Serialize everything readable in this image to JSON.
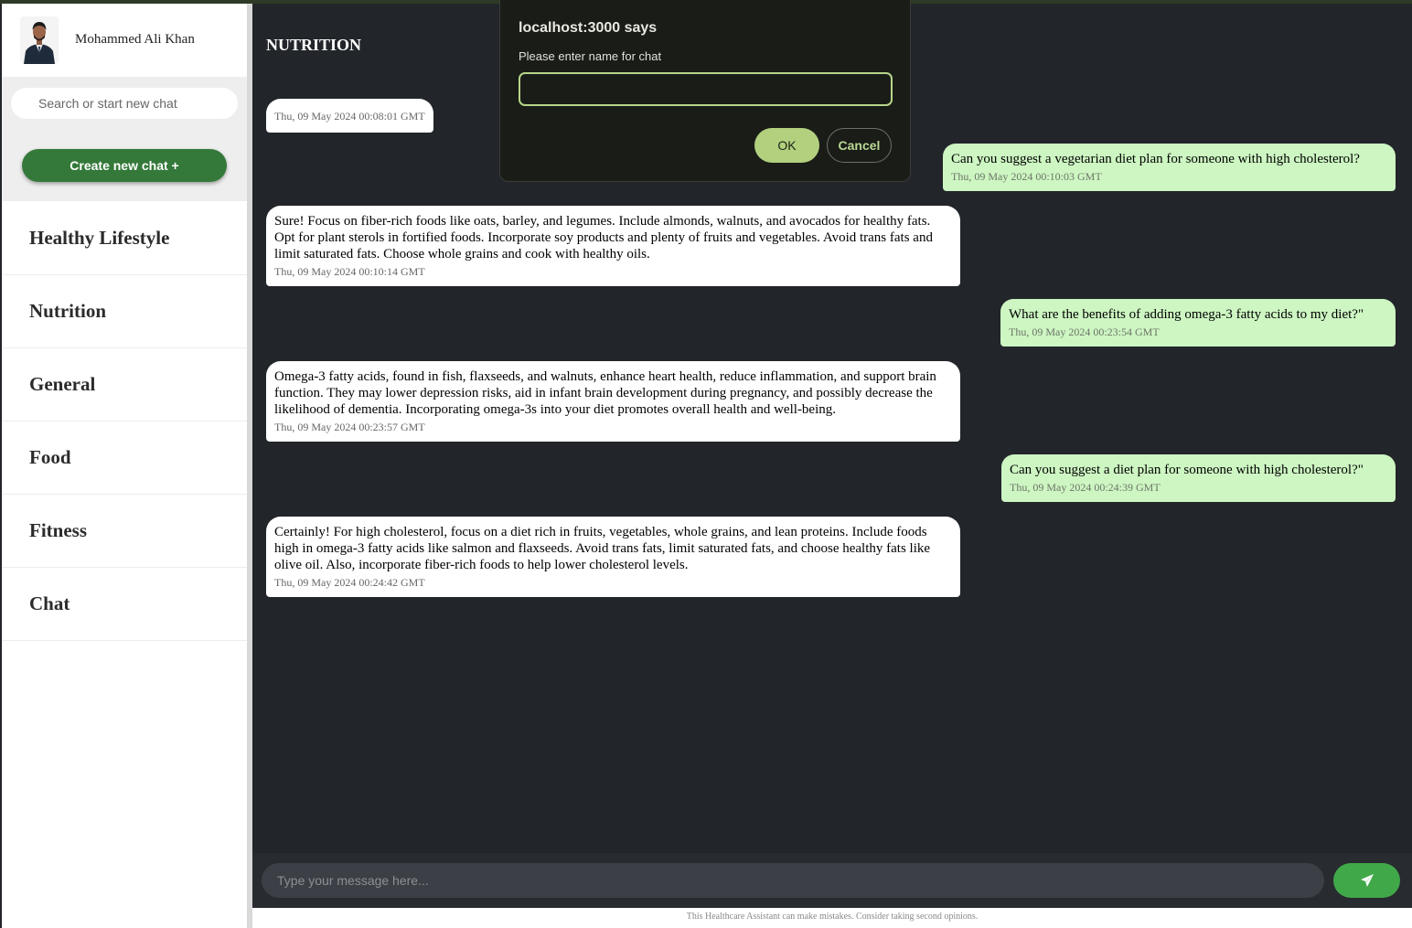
{
  "user": {
    "name": "Mohammed Ali Khan"
  },
  "sidebar": {
    "search_placeholder": "Search or start new chat",
    "create_button": "Create new chat +",
    "chats": [
      "Healthy Lifestyle",
      "Nutrition",
      "General",
      "Food",
      "Fitness",
      "Chat"
    ]
  },
  "main": {
    "title": "NUTRITION",
    "first_timestamp": "Thu, 09 May 2024 00:08:01 GMT",
    "messages": [
      {
        "role": "user",
        "text": "Can you suggest a vegetarian diet plan for someone with high cholesterol?",
        "time": "Thu, 09 May 2024 00:10:03 GMT"
      },
      {
        "role": "bot",
        "text": "Sure! Focus on fiber-rich foods like oats, barley, and legumes. Include almonds, walnuts, and avocados for healthy fats. Opt for plant sterols in fortified foods. Incorporate soy products and plenty of fruits and vegetables. Avoid trans fats and limit saturated fats. Choose whole grains and cook with healthy oils.",
        "time": "Thu, 09 May 2024 00:10:14 GMT"
      },
      {
        "role": "user",
        "text": "What are the benefits of adding omega-3 fatty acids to my diet?\"",
        "time": "Thu, 09 May 2024 00:23:54 GMT"
      },
      {
        "role": "bot",
        "text": "Omega-3 fatty acids, found in fish, flaxseeds, and walnuts, enhance heart health, reduce inflammation, and support brain function. They may lower depression risks, aid in infant brain development during pregnancy, and possibly decrease the likelihood of dementia. Incorporating omega-3s into your diet promotes overall health and well-being.",
        "time": "Thu, 09 May 2024 00:23:57 GMT"
      },
      {
        "role": "user",
        "text": "Can you suggest a diet plan for someone with high cholesterol?\"",
        "time": "Thu, 09 May 2024 00:24:39 GMT"
      },
      {
        "role": "bot",
        "text": "Certainly! For high cholesterol, focus on a diet rich in fruits, vegetables, whole grains, and lean proteins. Include foods high in omega-3 fatty acids like salmon and flaxseeds. Avoid trans fats, limit saturated fats, and choose healthy fats like olive oil. Also, incorporate fiber-rich foods to help lower cholesterol levels.",
        "time": "Thu, 09 May 2024 00:24:42 GMT"
      }
    ],
    "input_placeholder": "Type your message here...",
    "send_icon": "paper-plane-icon",
    "footer": "This Healthcare Assistant can make mistakes. Consider taking second opinions."
  },
  "dialog": {
    "title": "localhost:3000 says",
    "message": "Please enter name for chat",
    "input_value": "",
    "ok_label": "OK",
    "cancel_label": "Cancel"
  },
  "colors": {
    "main_bg": "#22252a",
    "create_button": "#34793a",
    "send_button": "#41a849",
    "user_bubble": "#cdf6c2",
    "dialog_accent": "#b2d07e"
  }
}
